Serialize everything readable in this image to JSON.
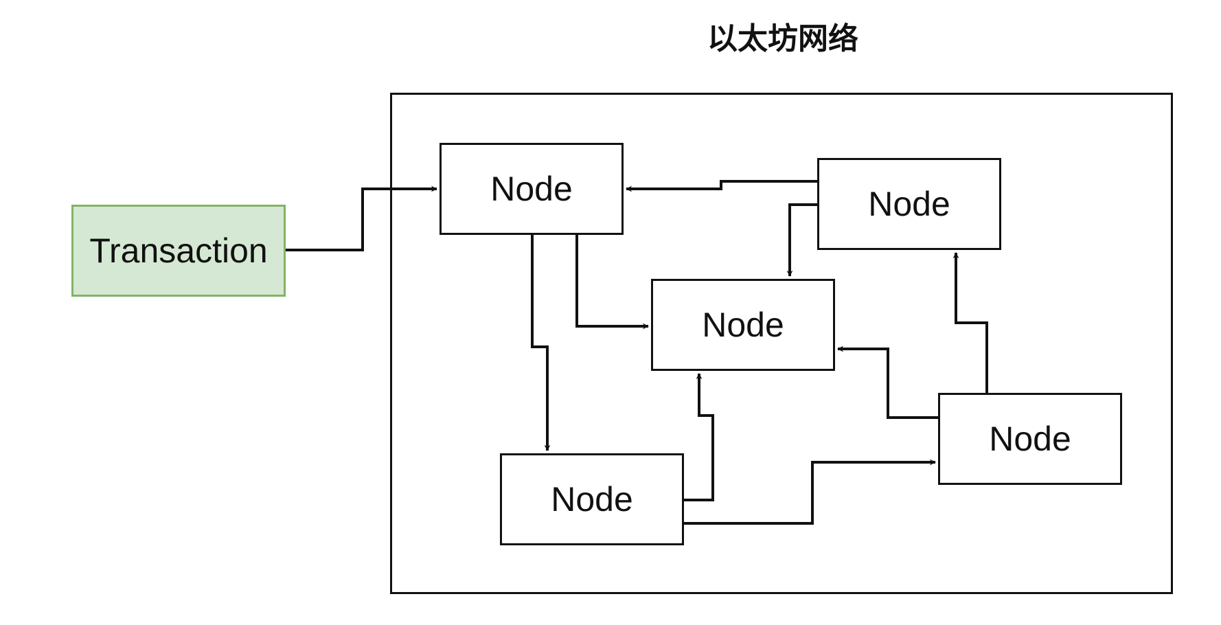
{
  "title": "以太坊网络",
  "transaction": {
    "label": "Transaction"
  },
  "nodes": [
    {
      "id": "n1",
      "label": "Node"
    },
    {
      "id": "n2",
      "label": "Node"
    },
    {
      "id": "n3",
      "label": "Node"
    },
    {
      "id": "n4",
      "label": "Node"
    },
    {
      "id": "n5",
      "label": "Node"
    }
  ],
  "edges": [
    {
      "from": "transaction",
      "to": "n1"
    },
    {
      "from": "n2",
      "to": "n1"
    },
    {
      "from": "n2",
      "to": "n3"
    },
    {
      "from": "n1",
      "to": "n3"
    },
    {
      "from": "n1",
      "to": "n4"
    },
    {
      "from": "n4",
      "to": "n3"
    },
    {
      "from": "n4",
      "to": "n5"
    },
    {
      "from": "n5",
      "to": "n3"
    },
    {
      "from": "n5",
      "to": "n2"
    }
  ],
  "colors": {
    "stroke": "#111111",
    "transaction_fill": "#d5e8d4",
    "transaction_border": "#82b366"
  }
}
